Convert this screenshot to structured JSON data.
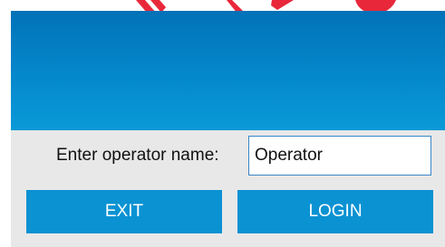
{
  "colors": {
    "banner_top": "#0272b8",
    "banner_bottom": "#0a9ad8",
    "button": "#0a92d2",
    "panel_background": "#e8e8e8",
    "logo_red": "#e8283a"
  },
  "login_form": {
    "operator_label": "Enter operator name:",
    "operator_value": "Operator"
  },
  "buttons": {
    "exit_label": "EXIT",
    "login_label": "LOGIN"
  }
}
